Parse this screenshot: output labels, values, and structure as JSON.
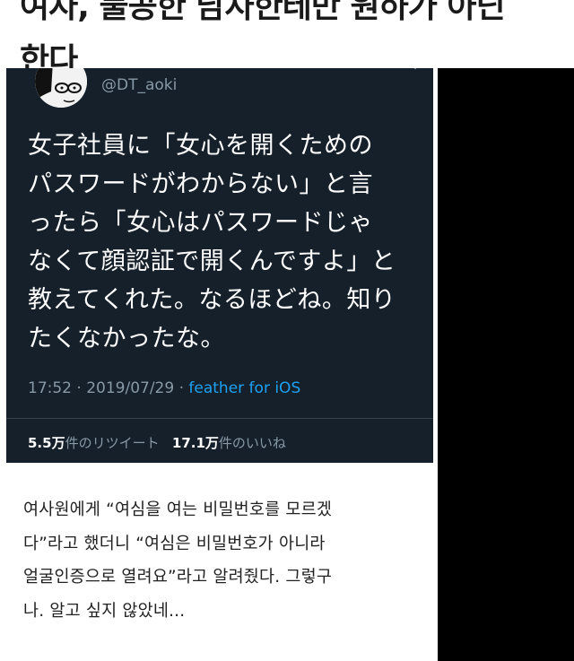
{
  "headline": {
    "line1": "여자, 불공한 남자한테만 원하가 아닌 ",
    "line2": "한다"
  },
  "tweet": {
    "handle": "@DT_aoki",
    "text_lines": [
      "女子社員に「女心を開くための",
      "パスワードがわからない」と言",
      "ったら「女心はパスワードじゃ",
      "なくて顔認証で開くんですよ」と",
      "教えてくれた。なるほどね。知り",
      "たくなかったな。"
    ],
    "meta": {
      "timestamp": "17:52 · 2019/07/29 · ",
      "client": "feather for iOS"
    },
    "stats": {
      "retweets_count": "5.5万",
      "retweets_label": "件のリツイート",
      "likes_count": "17.1万",
      "likes_label": "件のいいね"
    }
  },
  "translation": {
    "lines": [
      "여사원에게 “여심을 여는 비밀번호를 모르겠",
      "다”라고 했더니 “여심은 비밀번호가 아니라",
      "얼굴인증으로 열려요”라고 알려줬다. 그렇구",
      "나. 알고 싶지 않았네..."
    ]
  },
  "colors": {
    "tweet_background": "#15202b",
    "tweet_text": "#ffffff",
    "tweet_secondary": "#8899a6",
    "tweet_link": "#1da1f2",
    "panel": "#000000"
  }
}
